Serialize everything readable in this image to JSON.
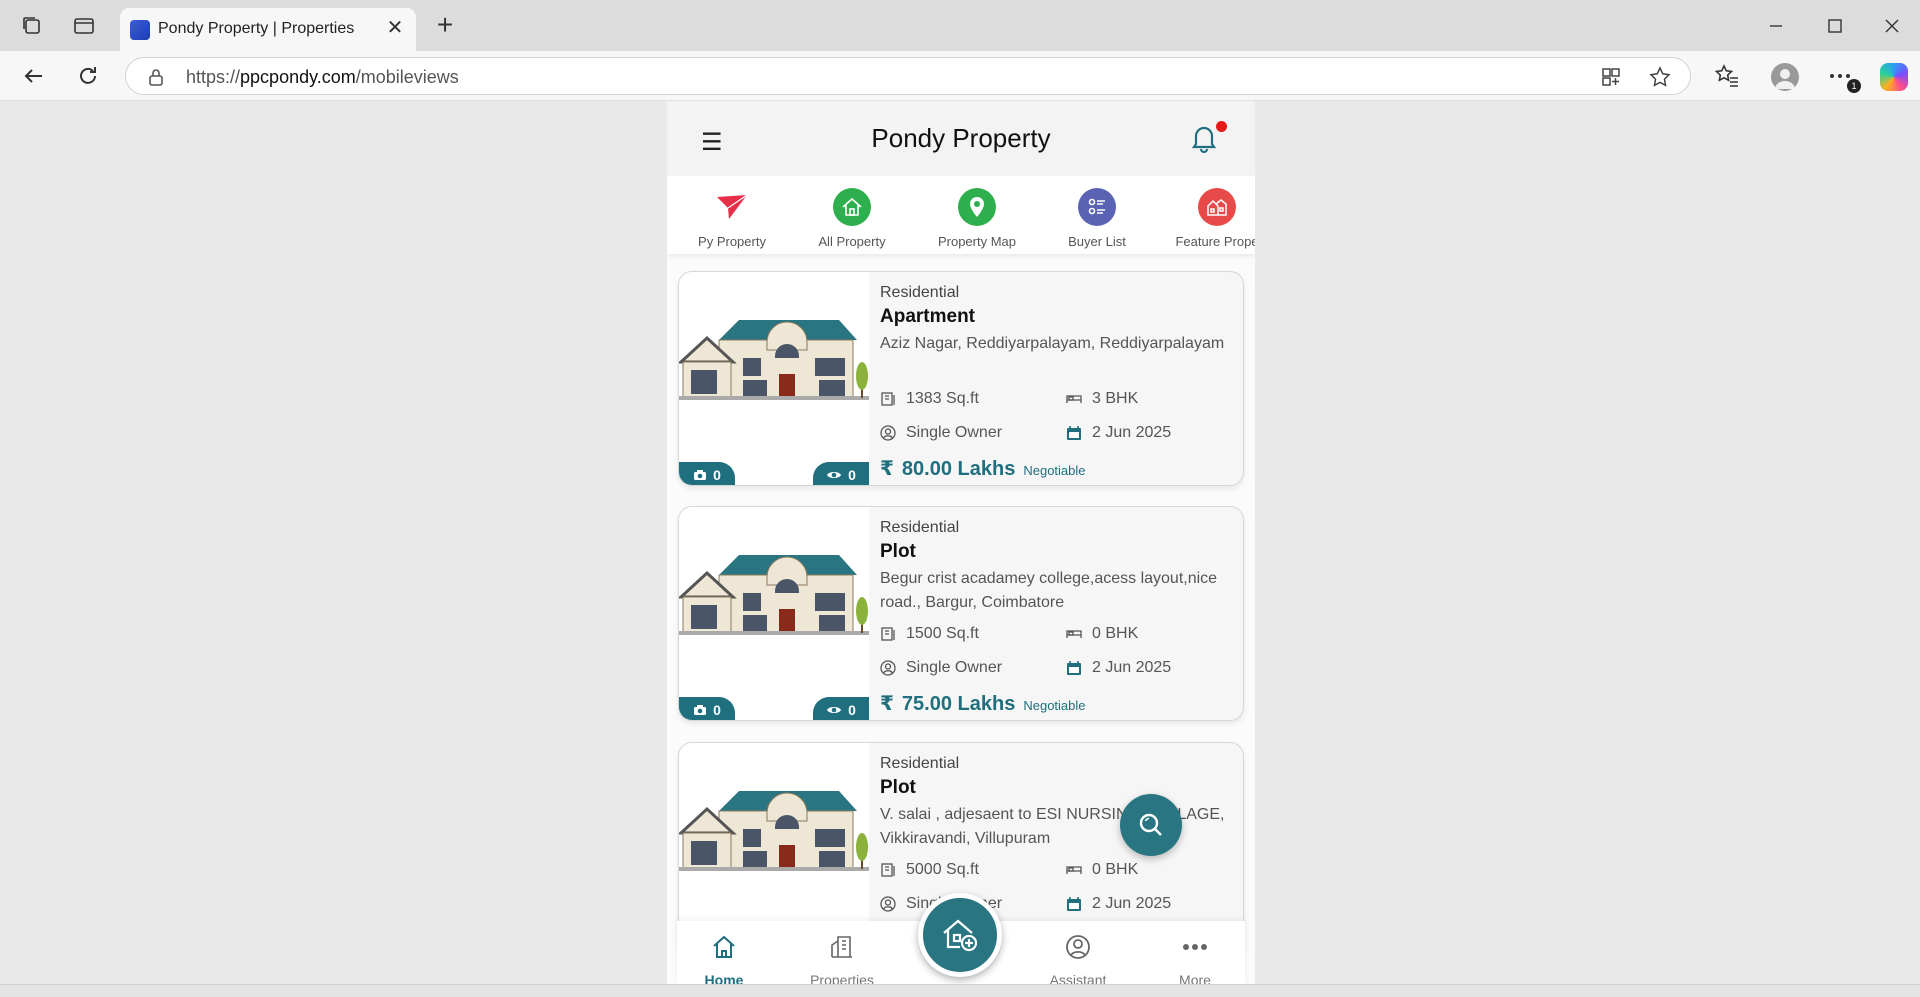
{
  "browser": {
    "tab_title": "Pondy Property | Properties",
    "url_scheme": "https://",
    "url_host": "ppcpondy.com",
    "url_path": "/mobileviews",
    "notification_count": "1"
  },
  "app": {
    "title": "Pondy Property",
    "categories": [
      {
        "label": "Py Property",
        "color": "#e6304a",
        "icon": "paper-plane-icon"
      },
      {
        "label": "All Property",
        "color": "#2eaf4d",
        "icon": "house-icon"
      },
      {
        "label": "Property Map",
        "color": "#2eaf4d",
        "icon": "map-pin-icon"
      },
      {
        "label": "Buyer List",
        "color": "#5a63b3",
        "icon": "list-icon"
      },
      {
        "label": "Feature Prope",
        "color": "#e84a4a",
        "icon": "building-icon"
      }
    ],
    "listings": [
      {
        "category": "Residential",
        "type": "Apartment",
        "address": "Aziz Nagar, Reddiyarpalayam, Reddiyarpalayam",
        "area": "1383 Sq.ft",
        "bhk": "3 BHK",
        "ownership": "Single Owner",
        "date": "2 Jun 2025",
        "price": "80.00 Lakhs",
        "negotiable": "Negotiable",
        "photos": "0",
        "views": "0"
      },
      {
        "category": "Residential",
        "type": "Plot",
        "address": "Begur crist acadamey college,acess layout,nice road., Bargur, Coimbatore",
        "area": "1500 Sq.ft",
        "bhk": "0 BHK",
        "ownership": "Single Owner",
        "date": "2 Jun 2025",
        "price": "75.00 Lakhs",
        "negotiable": "Negotiable",
        "photos": "0",
        "views": "0"
      },
      {
        "category": "Residential",
        "type": "Plot",
        "address": "V. salai , adjesaent to ESI NURSING COLLAGE, Vikkiravandi, Villupuram",
        "area": "5000 Sq.ft",
        "bhk": "0 BHK",
        "ownership": "Single Owner",
        "date": "2 Jun 2025"
      }
    ],
    "bottom_nav": [
      {
        "label": "Home"
      },
      {
        "label": "Properties"
      },
      {
        "label": "Assistant"
      },
      {
        "label": "More"
      }
    ],
    "rupee_symbol": "₹",
    "accent_color": "#1f6f7e"
  }
}
